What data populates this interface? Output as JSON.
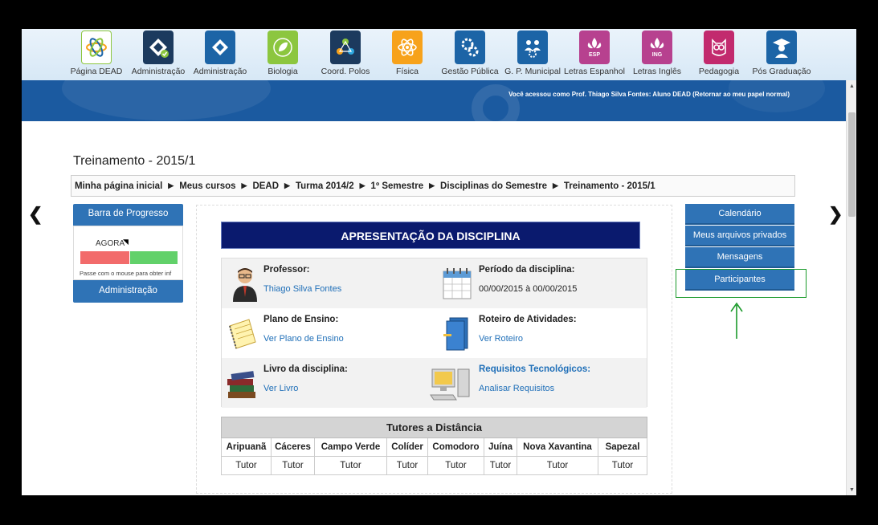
{
  "apps": [
    {
      "label": "Página DEAD",
      "icon": "atom-logo-icon",
      "color": "#ffffff"
    },
    {
      "label": "Administração",
      "icon": "admin-check-icon",
      "color": "#1c3a5e"
    },
    {
      "label": "Administração",
      "icon": "admin-icon",
      "color": "#1c64a6"
    },
    {
      "label": "Biologia",
      "icon": "leaf-icon",
      "color": "#8cc63f"
    },
    {
      "label": "Coord. Polos",
      "icon": "polos-icon",
      "color": "#1c3a5e"
    },
    {
      "label": "Física",
      "icon": "atom-icon",
      "color": "#f7a21b"
    },
    {
      "label": "Gestão Pública",
      "icon": "gears-icon",
      "color": "#1c64a6"
    },
    {
      "label": "G. P. Municipal",
      "icon": "people-gears-icon",
      "color": "#1c64a6"
    },
    {
      "label": "Letras Espanhol",
      "icon": "fleur-esp-icon",
      "color": "#b7418f",
      "badge": "ESP"
    },
    {
      "label": "Letras Inglês",
      "icon": "fleur-ing-icon",
      "color": "#b7418f",
      "badge": "ING"
    },
    {
      "label": "Pedagogia",
      "icon": "owl-icon",
      "color": "#c22a6e"
    },
    {
      "label": "Pós Graduação",
      "icon": "graduate-icon",
      "color": "#1c64a6"
    }
  ],
  "banner": {
    "login_text": "Você acessou como Prof. Thiago Silva Fontes: Aluno DEAD (Retornar ao meu papel normal)"
  },
  "page_title": "Treinamento - 2015/1",
  "breadcrumb": [
    "Minha página inicial",
    "Meus cursos",
    "DEAD",
    "Turma 2014/2",
    "1º Semestre",
    "Disciplinas do Semestre",
    "Treinamento - 2015/1"
  ],
  "left": {
    "progress_title": "Barra de Progresso",
    "now_label": "AGORA",
    "hint": "Passe com o mouse para obter inf",
    "progress_fraction": 0.5,
    "admin_title": "Administração"
  },
  "center": {
    "heading": "APRESENTAÇÃO DA DISCIPLINA",
    "items": [
      {
        "title": "Professor:",
        "value": "Thiago Silva Fontes",
        "icon": "professor-icon"
      },
      {
        "title": "Período da disciplina:",
        "value": "00/00/2015 à 00/00/2015",
        "icon": "calendar-icon"
      },
      {
        "title": "Plano de Ensino:",
        "value": "Ver Plano de Ensino",
        "icon": "notebook-icon"
      },
      {
        "title": "Roteiro de Atividades:",
        "value": "Ver Roteiro",
        "icon": "binder-icon"
      },
      {
        "title": "Livro da disciplina:",
        "value": "Ver Livro",
        "icon": "books-icon"
      },
      {
        "title": "Requisitos Tecnológicos:",
        "value": "Analisar Requisitos",
        "icon": "computer-icon"
      }
    ],
    "tutors_caption": "Tutores a Distância",
    "tutor_cities": [
      "Aripuanã",
      "Cáceres",
      "Campo Verde",
      "Colíder",
      "Comodoro",
      "Juína",
      "Nova Xavantina",
      "Sapezal"
    ],
    "tutor_values": [
      "Tutor",
      "Tutor",
      "Tutor",
      "Tutor",
      "Tutor",
      "Tutor",
      "Tutor",
      "Tutor"
    ]
  },
  "right_menu": [
    "Calendário",
    "Meus arquivos privados",
    "Mensagens",
    "Participantes"
  ],
  "colors": {
    "accent": "#2f73b6",
    "highlight": "#1a9a2a",
    "heading": "#0a1a6e"
  }
}
